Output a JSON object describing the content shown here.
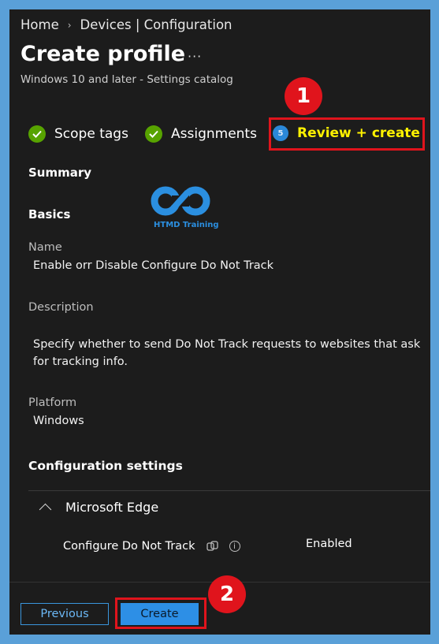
{
  "breadcrumb": {
    "home": "Home",
    "devices": "Devices | Configuration"
  },
  "page": {
    "title": "Create profile",
    "more": "···",
    "subtitle": "Windows 10 and later - Settings catalog"
  },
  "steps": [
    {
      "label": "Scope tags",
      "status": "complete"
    },
    {
      "label": "Assignments",
      "status": "complete"
    },
    {
      "label": "Review + create",
      "number": "5",
      "status": "active"
    }
  ],
  "summary": {
    "heading": "Summary",
    "basics_heading": "Basics",
    "name_label": "Name",
    "name_value": "Enable orr Disable Configure Do Not Track",
    "description_label": "Description",
    "description_value": "Specify whether to send Do Not Track requests to websites that ask for tracking info.",
    "platform_label": "Platform",
    "platform_value": "Windows"
  },
  "configuration": {
    "heading": "Configuration settings",
    "group_label": "Microsoft Edge",
    "setting_name": "Configure Do Not Track",
    "setting_value": "Enabled"
  },
  "watermark": {
    "text": "HTMD Training"
  },
  "footer": {
    "previous_label": "Previous",
    "create_label": "Create"
  },
  "callouts": {
    "one": "1",
    "two": "2"
  },
  "colors": {
    "accent": "#2d8fe6",
    "highlight": "#e0141c",
    "check": "#57a300",
    "active_step": "#fff200"
  }
}
